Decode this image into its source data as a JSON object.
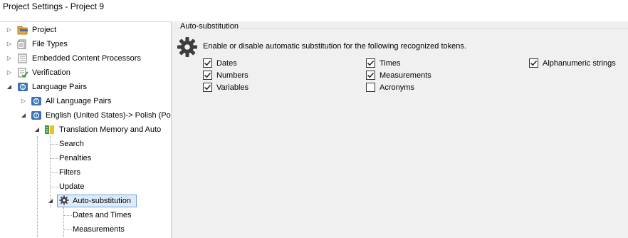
{
  "window": {
    "title": "Project Settings - Project 9"
  },
  "tree": {
    "items": [
      {
        "label": "Project",
        "icon": "project-icon"
      },
      {
        "label": "File Types",
        "icon": "file-types-icon"
      },
      {
        "label": "Embedded Content Processors",
        "icon": "embedded-content-icon"
      },
      {
        "label": "Verification",
        "icon": "verification-icon"
      },
      {
        "label": "Language Pairs",
        "icon": "language-pairs-icon"
      },
      {
        "label": "All Language Pairs",
        "icon": "language-pair-icon"
      },
      {
        "label": "English (United States)-> Polish (Po",
        "icon": "language-pair-icon"
      },
      {
        "label": "Translation Memory and Auto",
        "icon": "translation-memory-icon"
      },
      {
        "label": "Search"
      },
      {
        "label": "Penalties"
      },
      {
        "label": "Filters"
      },
      {
        "label": "Update"
      },
      {
        "label": "Auto-substitution",
        "icon": "gear-icon",
        "selected": true
      },
      {
        "label": "Dates and Times"
      },
      {
        "label": "Measurements"
      }
    ]
  },
  "panel": {
    "group_title": "Auto-substitution",
    "description": "Enable or disable automatic substitution for the following recognized tokens.",
    "checkboxes": [
      {
        "label": "Dates",
        "checked": true
      },
      {
        "label": "Numbers",
        "checked": true
      },
      {
        "label": "Variables",
        "checked": true
      },
      {
        "label": "Times",
        "checked": true
      },
      {
        "label": "Measurements",
        "checked": true
      },
      {
        "label": "Acronyms",
        "checked": false
      },
      {
        "label": "Alphanumeric strings",
        "checked": true
      }
    ]
  },
  "colors": {
    "selection_bg": "#dcebfc",
    "selection_border": "#6fa1d6",
    "panel_bg": "#f0f0f0"
  }
}
